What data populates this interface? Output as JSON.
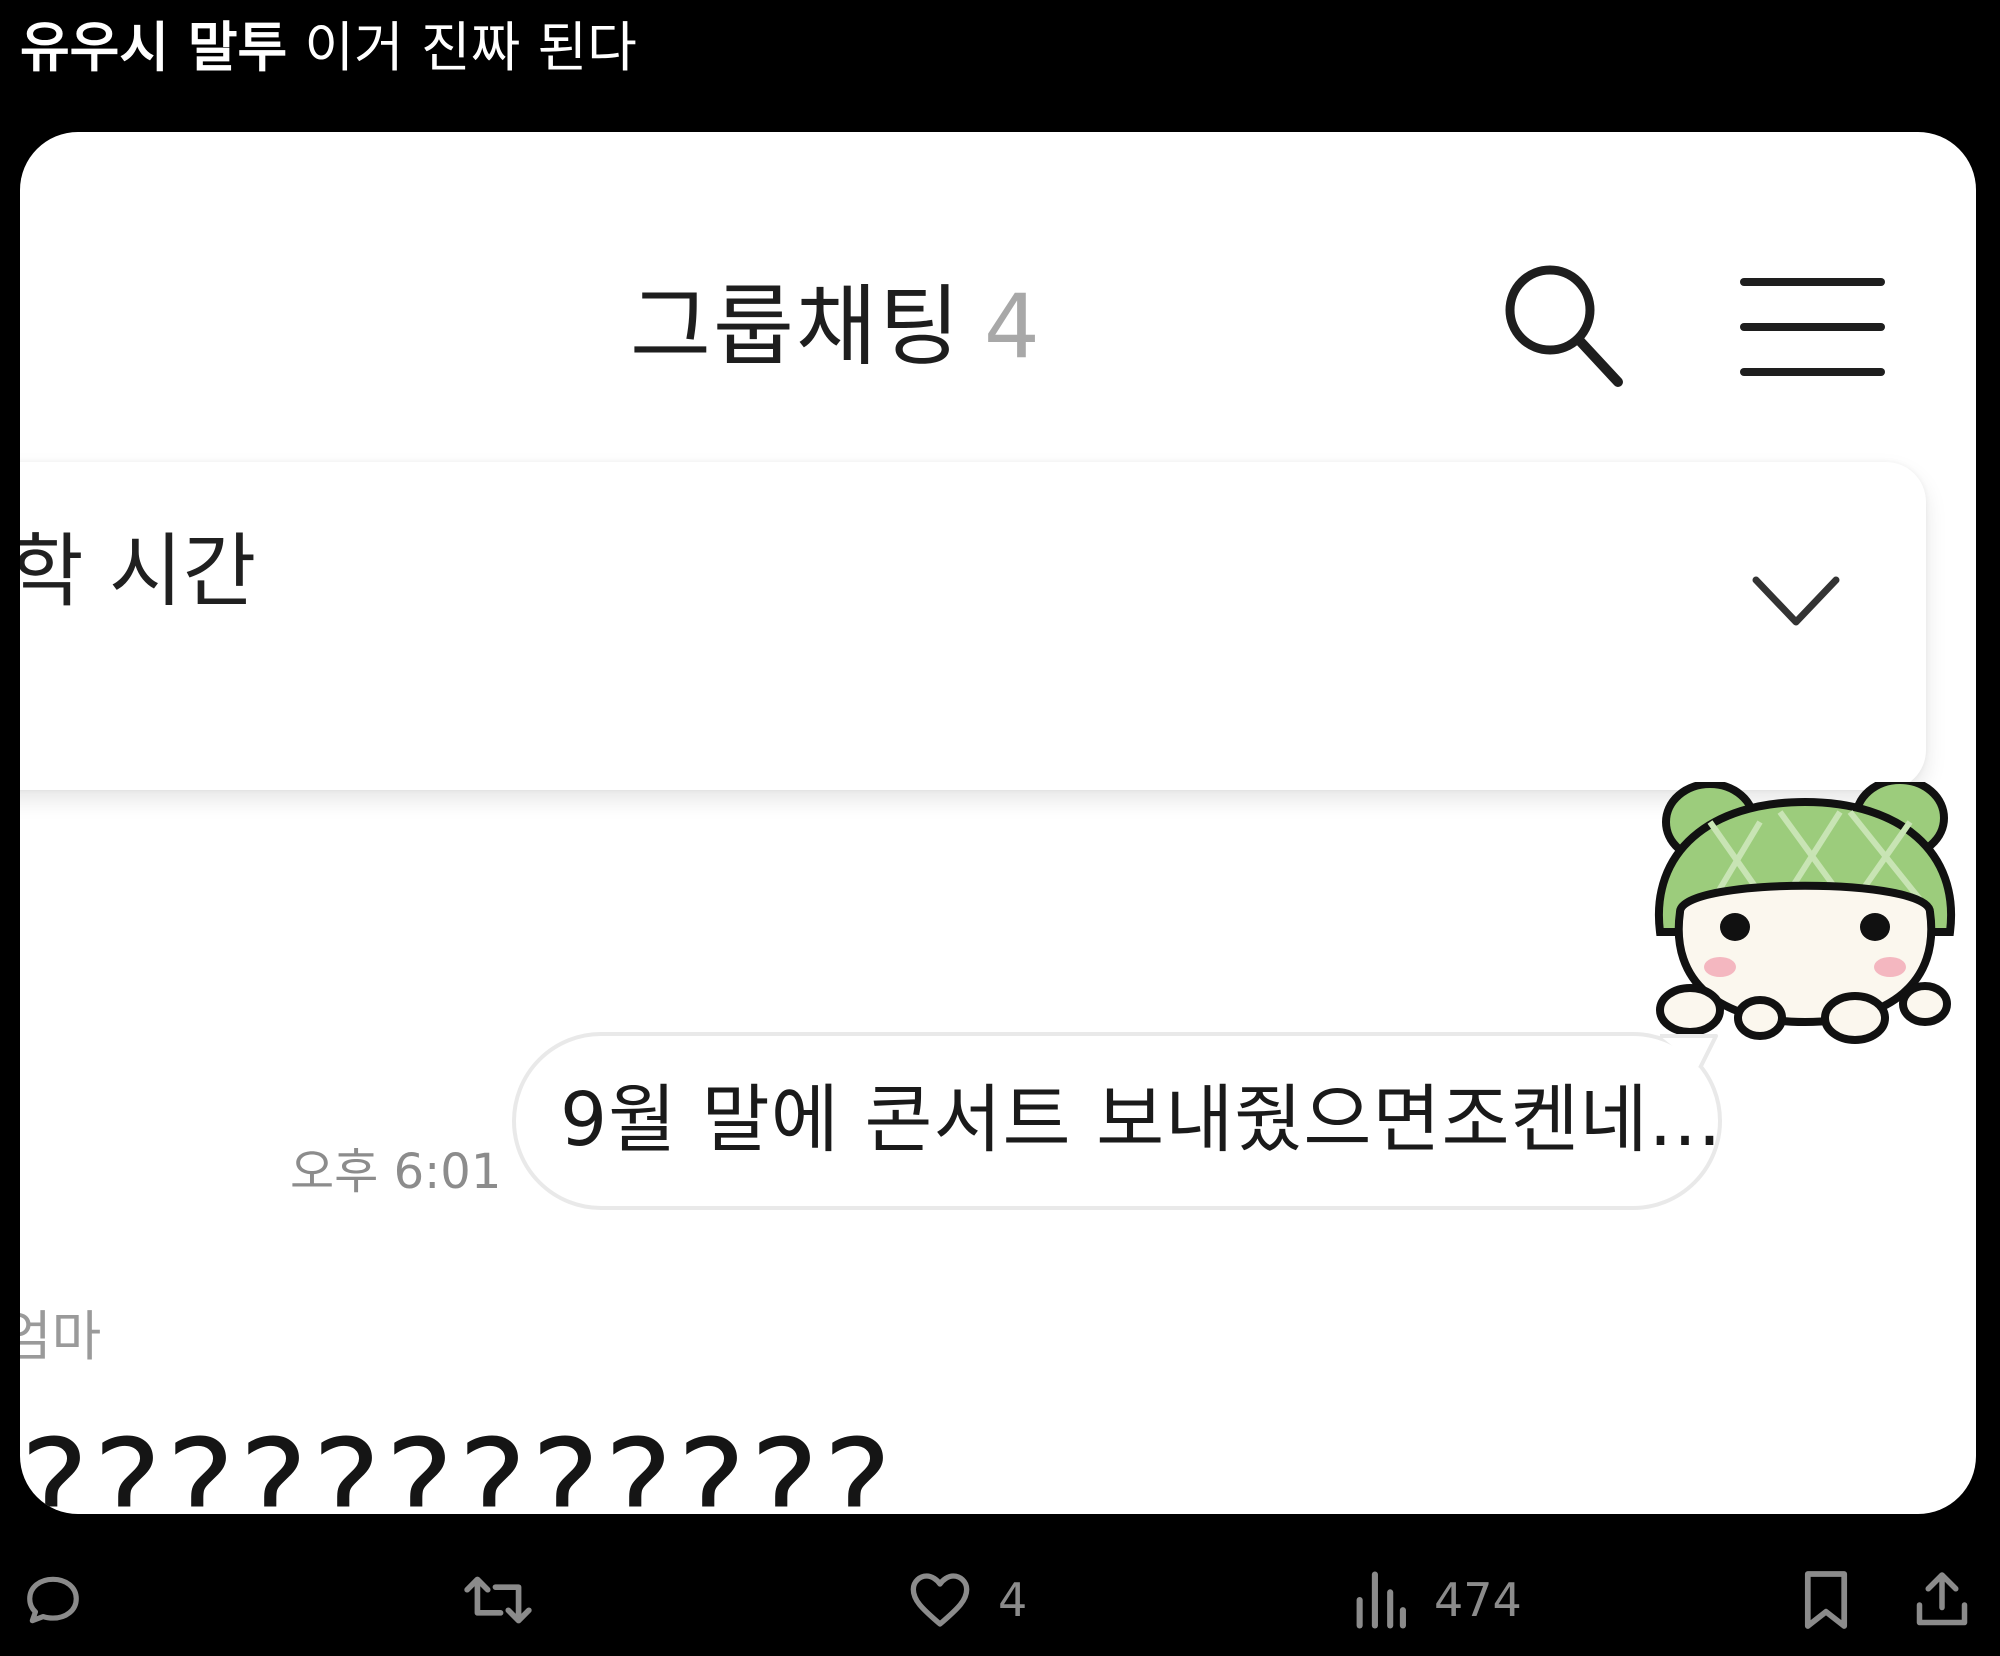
{
  "tweet": {
    "text_bold": "유우시 말투",
    "text_rest": " 이거 진짜 된다"
  },
  "chat": {
    "title": "그룹채팅",
    "member_count": "4",
    "notice": {
      "text": "학 시간"
    },
    "outgoing_message": {
      "text": "9월 말에 콘서트 보내줬으면조켄네...",
      "time": "오후 6:01"
    },
    "incoming": {
      "sender": "엄마",
      "text": "????????????"
    },
    "sticker": "green-frog-hat-character-sticker"
  },
  "actions": {
    "reply_icon": "reply-icon",
    "retweet_icon": "retweet-icon",
    "like_count": "4",
    "views_count": "474",
    "bookmark_icon": "bookmark-icon",
    "share_icon": "share-icon"
  },
  "colors": {
    "background": "#000000",
    "card": "#ffffff",
    "muted_text": "#8b8b8b",
    "sticker_green": "#9ccc7c"
  }
}
